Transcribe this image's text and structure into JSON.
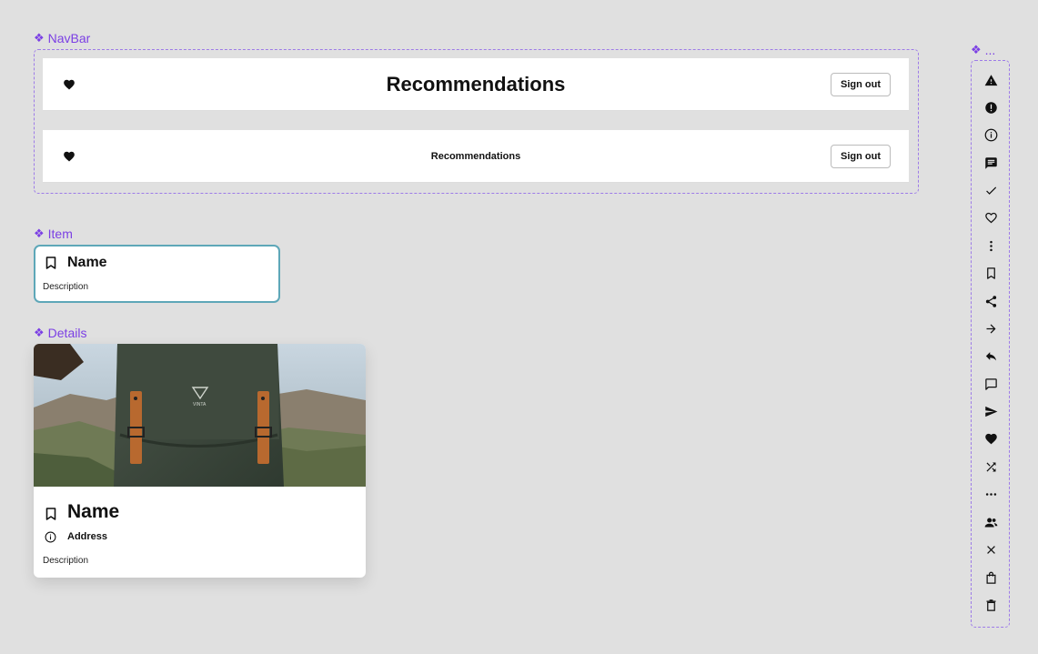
{
  "labels": {
    "navbar": "NavBar",
    "item": "Item",
    "details": "Details",
    "icons": "..."
  },
  "navbar_large": {
    "title": "Recommendations",
    "signout_label": "Sign out",
    "left_icon": "heart-icon"
  },
  "navbar_small": {
    "title": "Recommendations",
    "signout_label": "Sign out",
    "left_icon": "heart-icon"
  },
  "item": {
    "name": "Name",
    "description": "Description",
    "icon": "bookmark-icon"
  },
  "details": {
    "name": "Name",
    "address": "Address",
    "description": "Description",
    "image": "backpack-photo",
    "backpack_brand": "VINTA"
  },
  "icons": [
    "warning-icon",
    "error-icon",
    "info-icon",
    "chat-icon",
    "check-icon",
    "heart-outline-icon",
    "more-vertical-icon",
    "bookmark-icon",
    "share-icon",
    "arrow-right-icon",
    "reply-icon",
    "comment-icon",
    "send-icon",
    "heart-icon",
    "shuffle-icon",
    "more-horizontal-icon",
    "people-icon",
    "close-icon",
    "shopping-bag-icon",
    "trash-icon"
  ],
  "colors": {
    "component_label": "#7b3fe4",
    "dashed_border": "#9d7be8",
    "item_border": "#5ea7b8",
    "background": "#e0e0e0"
  }
}
